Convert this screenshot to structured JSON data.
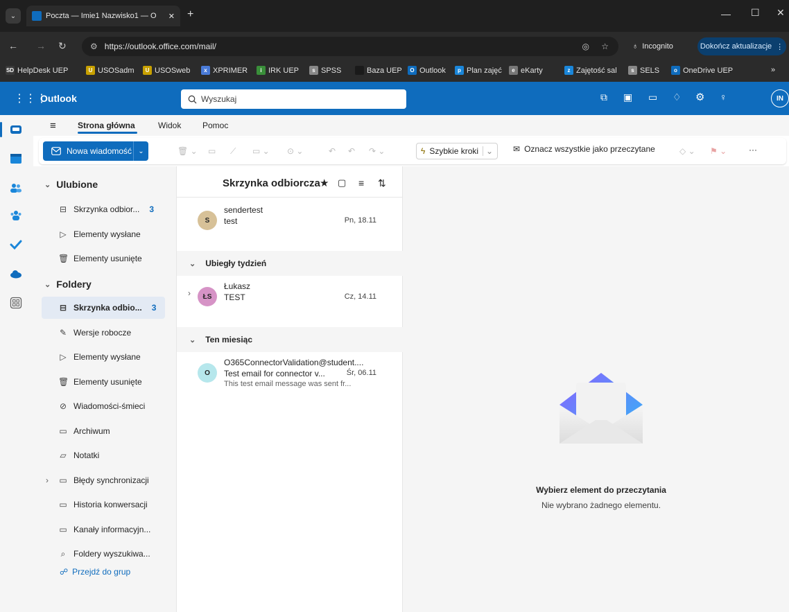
{
  "browser": {
    "tab_title": "Poczta — Imie1 Nazwisko1 — O",
    "url": "https://outlook.office.com/mail/",
    "incognito_label": "Incognito",
    "update_label": "Dokończ aktualizacje",
    "bookmarks": [
      {
        "label": "HelpDesk UEP",
        "icon": "SD"
      },
      {
        "label": "USOSadm",
        "icon": "U"
      },
      {
        "label": "USOSweb",
        "icon": "U"
      },
      {
        "label": "XPRIMER",
        "icon": "x"
      },
      {
        "label": "IRK UEP",
        "icon": "i"
      },
      {
        "label": "SPSS",
        "icon": "s"
      },
      {
        "label": "Baza UEP",
        "icon": ""
      },
      {
        "label": "Outlook",
        "icon": "O"
      },
      {
        "label": "Plan zajęć",
        "icon": "p"
      },
      {
        "label": "eKarty",
        "icon": "e"
      },
      {
        "label": "Zajętość sal",
        "icon": "z"
      },
      {
        "label": "SELS",
        "icon": "s"
      },
      {
        "label": "OneDrive UEP",
        "icon": "o"
      }
    ]
  },
  "app": {
    "name": "Outlook",
    "search_placeholder": "Wyszukaj",
    "avatar_initials": "IN"
  },
  "ribbon": {
    "tabs": [
      "Strona główna",
      "Widok",
      "Pomoc"
    ],
    "new_message": "Nowa wiadomość",
    "quick_steps": "Szybkie kroki",
    "mark_all_read": "Oznacz wszystkie jako przeczytane",
    "more": "···"
  },
  "folders": {
    "favorites_header": "Ulubione",
    "favorites": [
      {
        "label": "Skrzynka odbior...",
        "count": "3",
        "icon": "inbox-icon"
      },
      {
        "label": "Elementy wysłane",
        "count": "",
        "icon": "send-icon"
      },
      {
        "label": "Elementy usunięte",
        "count": "",
        "icon": "trash-icon"
      }
    ],
    "folders_header": "Foldery",
    "items": [
      {
        "label": "Skrzynka odbio...",
        "count": "3",
        "icon": "inbox-icon"
      },
      {
        "label": "Wersje robocze",
        "count": "",
        "icon": "draft-icon"
      },
      {
        "label": "Elementy wysłane",
        "count": "",
        "icon": "send-icon"
      },
      {
        "label": "Elementy usunięte",
        "count": "",
        "icon": "trash-icon"
      },
      {
        "label": "Wiadomości-śmieci",
        "count": "",
        "icon": "junk-icon"
      },
      {
        "label": "Archiwum",
        "count": "",
        "icon": "archive-icon"
      },
      {
        "label": "Notatki",
        "count": "",
        "icon": "notes-icon"
      },
      {
        "label": "Błędy synchronizacji",
        "count": "",
        "icon": "folder-icon"
      },
      {
        "label": "Historia konwersacji",
        "count": "",
        "icon": "folder-icon"
      },
      {
        "label": "Kanały informacyjn...",
        "count": "",
        "icon": "folder-icon"
      },
      {
        "label": "Foldery wyszukiwa...",
        "count": "",
        "icon": "search-folder-icon"
      }
    ],
    "groups_link": "Przejdź do grup"
  },
  "list": {
    "title": "Skrzynka odbiorcza",
    "messages_top": [
      {
        "initials": "S",
        "sender": "sendertest",
        "subject": "test",
        "date": "Pn, 18.11",
        "preview": "",
        "color": "#d7c198"
      }
    ],
    "group1": "Ubiegły tydzień",
    "messages_g1": [
      {
        "initials": "ŁS",
        "sender": "Łukasz",
        "subject": "TEST",
        "date": "Cz, 14.11",
        "preview": "",
        "color": "#d693c6"
      }
    ],
    "group2": "Ten miesiąc",
    "messages_g2": [
      {
        "initials": "O",
        "sender": "O365ConnectorValidation@student....",
        "subject": "Test email for connector v...",
        "date": "Śr, 06.11",
        "preview": "This test email message was sent fr...",
        "color": "#b6e7ec"
      }
    ]
  },
  "reading": {
    "title": "Wybierz element do przeczytania",
    "subtitle": "Nie wybrano żadnego elementu."
  },
  "colors": {
    "brand": "#0f6cbd",
    "unread_count": "#0f6cbd"
  }
}
